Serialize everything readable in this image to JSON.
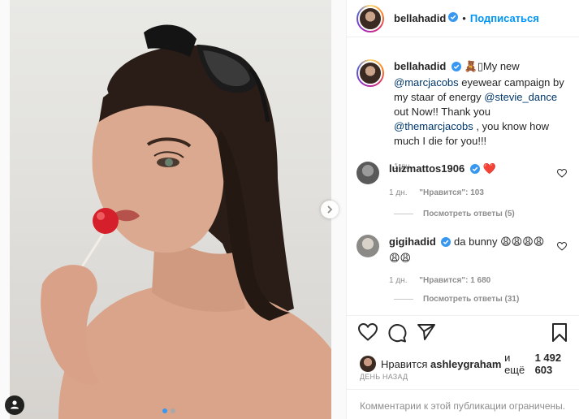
{
  "post": {
    "author": "bellahadid",
    "follow_label": "Подписаться",
    "separator": "•"
  },
  "caption": {
    "author": "bellahadid",
    "emoji": "🧸",
    "box_char": "▯",
    "text_1": "My new ",
    "mention_1": "@marcjacobs",
    "text_2": " eyewear campaign by my staar of energy ",
    "mention_2": "@stevie_dance",
    "text_3": " out Now!! Thank you ",
    "mention_3": "@themarcjacobs",
    "text_4": " , you know how much I die for you!!!",
    "time": "1 дн."
  },
  "comments": [
    {
      "author": "luizmattos1906",
      "text": "❤️",
      "time": "1 дн.",
      "likes": "\"Нравится\": 103",
      "replies": "Посмотреть ответы (5)"
    },
    {
      "author": "gigihadid",
      "text": "da bunny 😩😩😩😩😩😩",
      "time": "1 дн.",
      "likes": "\"Нравится\": 1 680",
      "replies": "Посмотреть ответы (31)"
    }
  ],
  "likes": {
    "prefix": "Нравится",
    "user": "ashleygraham",
    "middle": "и ещё",
    "count": "1 492 603"
  },
  "date": "ДЕНЬ НАЗАД",
  "comments_disabled": "Комментарии к этой публикации ограничены.",
  "carousel": {
    "total": 2,
    "current": 1
  },
  "icons": {
    "verified": "verified-badge-icon",
    "like": "heart-icon",
    "comment": "comment-icon",
    "share": "paper-plane-icon",
    "save": "bookmark-icon",
    "next": "chevron-right-icon",
    "tag": "user-tag-icon"
  },
  "colors": {
    "accent": "#0095f6",
    "verified": "#3897f0",
    "muted": "#8e8e8e",
    "heart": "#ed4956"
  }
}
